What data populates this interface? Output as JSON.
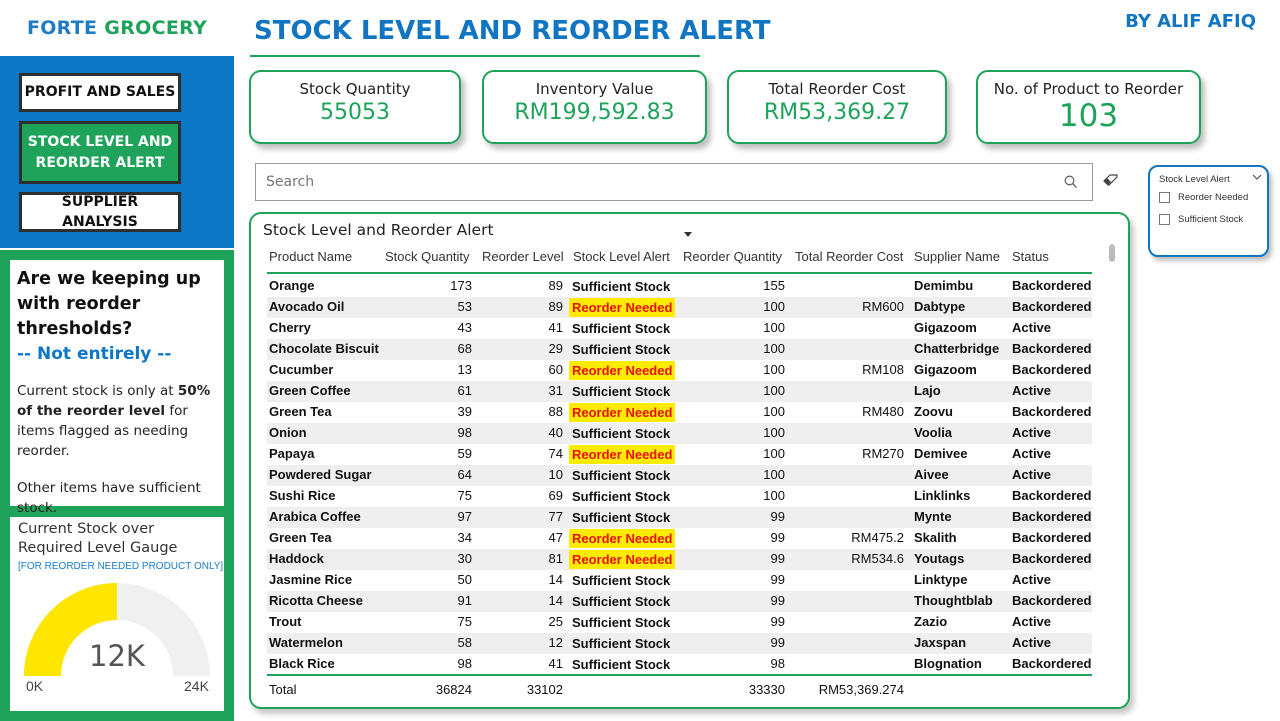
{
  "brand": {
    "part1": "FORTE",
    "part2": "GROCERY"
  },
  "nav": {
    "profit": "PROFIT AND SALES",
    "stock_line1": "STOCK LEVEL AND",
    "stock_line2": "REORDER ALERT",
    "supplier": "SUPPLIER ANALYSIS"
  },
  "insight": {
    "question": "Are we keeping up with reorder thresholds?",
    "answer": "-- Not entirely --",
    "text_before": "Current stock is only at ",
    "text_bold": "50% of the reorder level",
    "text_after": " for items flagged as needing reorder.",
    "text2": "Other items have sufficient stock."
  },
  "gauge": {
    "title": "Current Stock over Required Level Gauge",
    "note": "[FOR REORDER NEEDED PRODUCT ONLY]",
    "value_label": "12K",
    "min_label": "0K",
    "max_label": "24K",
    "value": 12,
    "max": 24,
    "fill_color": "#ffe600",
    "track_color": "#f0f0f0"
  },
  "header": {
    "title": "STOCK LEVEL AND REORDER ALERT",
    "byline": "BY ALIF AFIQ"
  },
  "kpis": {
    "stock_qty": {
      "label": "Stock Quantity",
      "value": "55053"
    },
    "inventory": {
      "label": "Inventory Value",
      "value": "RM199,592.83"
    },
    "reorder_cost": {
      "label": "Total Reorder Cost",
      "value": "RM53,369.27"
    },
    "products": {
      "label": "No. of Product to Reorder",
      "value": "103"
    }
  },
  "search": {
    "placeholder": "Search"
  },
  "slicer": {
    "title": "Stock Level Alert",
    "options": [
      "Reorder Needed",
      "Sufficient Stock"
    ]
  },
  "table": {
    "title": "Stock Level and Reorder Alert",
    "columns": [
      "Product Name",
      "Stock Quantity",
      "Reorder Level",
      "Stock Level Alert",
      "Reorder Quantity",
      "Total Reorder Cost",
      "Supplier Name",
      "Status"
    ],
    "rows": [
      [
        "Orange",
        "173",
        "89",
        "Sufficient Stock",
        "155",
        "",
        "Demimbu",
        "Backordered"
      ],
      [
        "Avocado Oil",
        "53",
        "89",
        "Reorder Needed",
        "100",
        "RM600",
        "Dabtype",
        "Backordered"
      ],
      [
        "Cherry",
        "43",
        "41",
        "Sufficient Stock",
        "100",
        "",
        "Gigazoom",
        "Active"
      ],
      [
        "Chocolate Biscuit",
        "68",
        "29",
        "Sufficient Stock",
        "100",
        "",
        "Chatterbridge",
        "Backordered"
      ],
      [
        "Cucumber",
        "13",
        "60",
        "Reorder Needed",
        "100",
        "RM108",
        "Gigazoom",
        "Backordered"
      ],
      [
        "Green Coffee",
        "61",
        "31",
        "Sufficient Stock",
        "100",
        "",
        "Lajo",
        "Active"
      ],
      [
        "Green Tea",
        "39",
        "88",
        "Reorder Needed",
        "100",
        "RM480",
        "Zoovu",
        "Backordered"
      ],
      [
        "Onion",
        "98",
        "40",
        "Sufficient Stock",
        "100",
        "",
        "Voolia",
        "Active"
      ],
      [
        "Papaya",
        "59",
        "74",
        "Reorder Needed",
        "100",
        "RM270",
        "Demivee",
        "Active"
      ],
      [
        "Powdered Sugar",
        "64",
        "10",
        "Sufficient Stock",
        "100",
        "",
        "Aivee",
        "Active"
      ],
      [
        "Sushi Rice",
        "75",
        "69",
        "Sufficient Stock",
        "100",
        "",
        "Linklinks",
        "Backordered"
      ],
      [
        "Arabica Coffee",
        "97",
        "77",
        "Sufficient Stock",
        "99",
        "",
        "Mynte",
        "Backordered"
      ],
      [
        "Green Tea",
        "34",
        "47",
        "Reorder Needed",
        "99",
        "RM475.2",
        "Skalith",
        "Backordered"
      ],
      [
        "Haddock",
        "30",
        "81",
        "Reorder Needed",
        "99",
        "RM534.6",
        "Youtags",
        "Backordered"
      ],
      [
        "Jasmine Rice",
        "50",
        "14",
        "Sufficient Stock",
        "99",
        "",
        "Linktype",
        "Active"
      ],
      [
        "Ricotta Cheese",
        "91",
        "14",
        "Sufficient Stock",
        "99",
        "",
        "Thoughtblab",
        "Backordered"
      ],
      [
        "Trout",
        "75",
        "25",
        "Sufficient Stock",
        "99",
        "",
        "Zazio",
        "Active"
      ],
      [
        "Watermelon",
        "58",
        "12",
        "Sufficient Stock",
        "99",
        "",
        "Jaxspan",
        "Active"
      ],
      [
        "Black Rice",
        "98",
        "41",
        "Sufficient Stock",
        "98",
        "",
        "Blognation",
        "Backordered"
      ]
    ],
    "total": {
      "label": "Total",
      "stock_qty": "36824",
      "reorder_level": "33102",
      "reorder_qty": "33330",
      "reorder_cost": "RM53,369.274"
    }
  },
  "colors": {
    "blue": "#0c77c7",
    "green": "#1fa35b",
    "alert_bg": "#ffeb00",
    "alert_text": "#e81010"
  }
}
